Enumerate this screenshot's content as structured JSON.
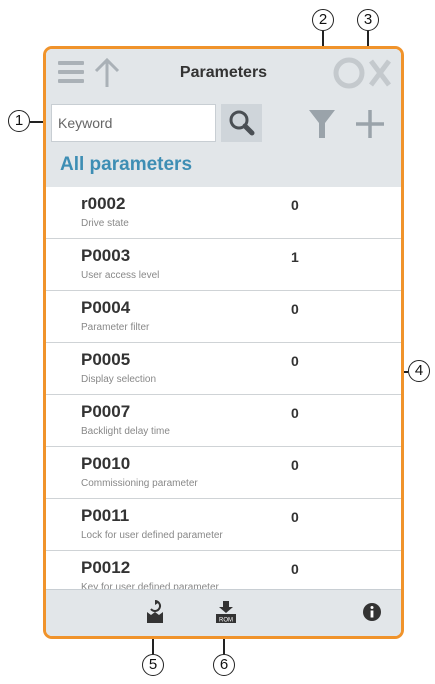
{
  "header": {
    "title": "Parameters"
  },
  "search": {
    "placeholder": "Keyword"
  },
  "section": {
    "title": "All parameters"
  },
  "parameters": [
    {
      "id": "r0002",
      "desc": "Drive state",
      "value": "0"
    },
    {
      "id": "P0003",
      "desc": "User access level",
      "value": "1"
    },
    {
      "id": "P0004",
      "desc": "Parameter filter",
      "value": "0"
    },
    {
      "id": "P0005",
      "desc": "Display selection",
      "value": "0"
    },
    {
      "id": "P0007",
      "desc": "Backlight delay time",
      "value": "0"
    },
    {
      "id": "P0010",
      "desc": "Commissioning parameter",
      "value": "0"
    },
    {
      "id": "P0011",
      "desc": "Lock for user defined parameter",
      "value": "0"
    },
    {
      "id": "P0012",
      "desc": "Key for user defined parameter",
      "value": "0"
    }
  ],
  "footer": {
    "rom_label": "ROM"
  },
  "callouts": {
    "c1": "1",
    "c2": "2",
    "c3": "3",
    "c4": "4",
    "c5": "5",
    "c6": "6"
  },
  "colors": {
    "frame": "#f0932b",
    "header_bg": "#e2e6e9",
    "section_title": "#3e8eb4",
    "icon": "#9aa3aa"
  },
  "icons": {
    "menu": "menu-icon",
    "up": "up-arrow-icon",
    "search": "search-icon",
    "filter": "filter-icon",
    "add": "plus-icon",
    "upload": "upload-to-drive-icon",
    "rom": "save-to-rom-icon",
    "info": "info-icon"
  }
}
